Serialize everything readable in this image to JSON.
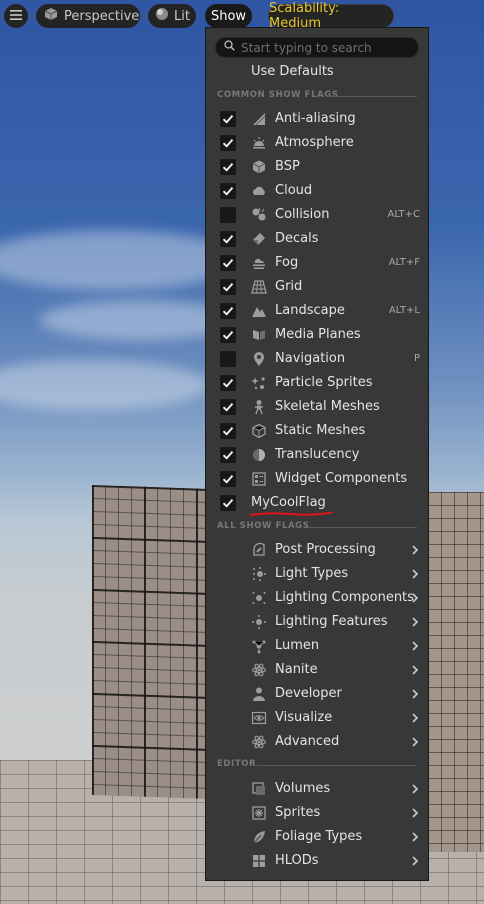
{
  "toolbar": {
    "perspective_label": "Perspective",
    "lit_label": "Lit",
    "show_label": "Show",
    "scalability_label": "Scalability: Medium"
  },
  "menu": {
    "search_placeholder": "Start typing to search",
    "use_defaults_label": "Use Defaults",
    "common_header": "COMMON SHOW FLAGS",
    "all_header": "ALL SHOW FLAGS",
    "editor_header": "EDITOR",
    "common_flags": [
      {
        "label": "Anti-aliasing",
        "checked": true,
        "shortcut": "",
        "icon": "anti-aliasing-icon"
      },
      {
        "label": "Atmosphere",
        "checked": true,
        "shortcut": "",
        "icon": "atmosphere-icon"
      },
      {
        "label": "BSP",
        "checked": true,
        "shortcut": "",
        "icon": "bsp-icon"
      },
      {
        "label": "Cloud",
        "checked": true,
        "shortcut": "",
        "icon": "cloud-icon"
      },
      {
        "label": "Collision",
        "checked": false,
        "shortcut": "ALT+C",
        "icon": "collision-icon"
      },
      {
        "label": "Decals",
        "checked": true,
        "shortcut": "",
        "icon": "decals-icon"
      },
      {
        "label": "Fog",
        "checked": true,
        "shortcut": "ALT+F",
        "icon": "fog-icon"
      },
      {
        "label": "Grid",
        "checked": true,
        "shortcut": "",
        "icon": "grid-icon"
      },
      {
        "label": "Landscape",
        "checked": true,
        "shortcut": "ALT+L",
        "icon": "landscape-icon"
      },
      {
        "label": "Media Planes",
        "checked": true,
        "shortcut": "",
        "icon": "media-planes-icon"
      },
      {
        "label": "Navigation",
        "checked": false,
        "shortcut": "P",
        "icon": "navigation-icon"
      },
      {
        "label": "Particle Sprites",
        "checked": true,
        "shortcut": "",
        "icon": "particle-sprites-icon"
      },
      {
        "label": "Skeletal Meshes",
        "checked": true,
        "shortcut": "",
        "icon": "skeletal-meshes-icon"
      },
      {
        "label": "Static Meshes",
        "checked": true,
        "shortcut": "",
        "icon": "static-meshes-icon"
      },
      {
        "label": "Translucency",
        "checked": true,
        "shortcut": "",
        "icon": "translucency-icon"
      },
      {
        "label": "Widget Components",
        "checked": true,
        "shortcut": "",
        "icon": "widget-components-icon"
      }
    ],
    "custom_flag": {
      "label": "MyCoolFlag",
      "checked": true
    },
    "all_flags": [
      {
        "label": "Post Processing",
        "icon": "post-processing-icon"
      },
      {
        "label": "Light Types",
        "icon": "light-types-icon"
      },
      {
        "label": "Lighting Components",
        "icon": "lighting-components-icon"
      },
      {
        "label": "Lighting Features",
        "icon": "lighting-features-icon"
      },
      {
        "label": "Lumen",
        "icon": "lumen-icon"
      },
      {
        "label": "Nanite",
        "icon": "nanite-icon"
      },
      {
        "label": "Developer",
        "icon": "developer-icon"
      },
      {
        "label": "Visualize",
        "icon": "visualize-icon"
      },
      {
        "label": "Advanced",
        "icon": "advanced-icon"
      }
    ],
    "editor_flags": [
      {
        "label": "Volumes",
        "icon": "volumes-icon"
      },
      {
        "label": "Sprites",
        "icon": "sprites-icon"
      },
      {
        "label": "Foliage Types",
        "icon": "foliage-types-icon"
      },
      {
        "label": "HLODs",
        "icon": "hlods-icon"
      }
    ]
  },
  "colors": {
    "menu_bg": "#383838",
    "accent_yellow": "#e8c72c",
    "annotation_red": "#e0151a"
  }
}
